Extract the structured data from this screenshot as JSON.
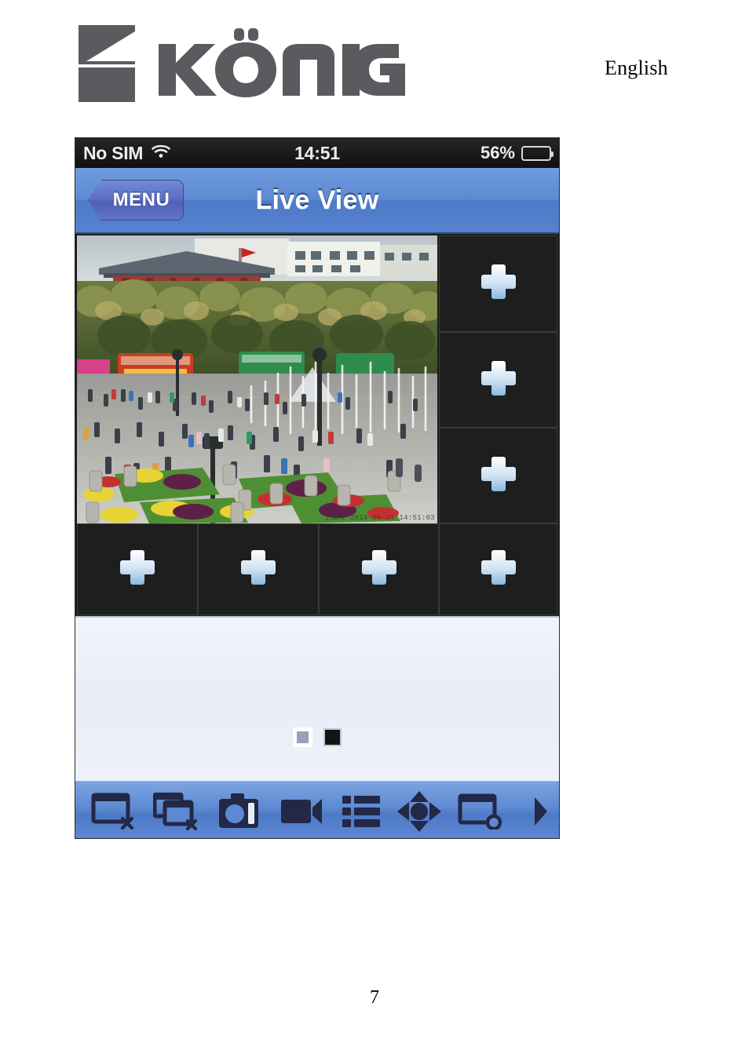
{
  "document": {
    "language_label": "English",
    "page_number": "7",
    "brand_name": "KÖNIG"
  },
  "phone": {
    "status_bar": {
      "carrier": "No SIM",
      "wifi_icon": "wifi-icon",
      "time": "14:51",
      "battery_percent": "56%",
      "battery_level": 56,
      "battery_icon": "battery-icon"
    },
    "nav_bar": {
      "back_button_label": "MENU",
      "title": "Live View"
    },
    "camera_grid": {
      "live_feed": {
        "label": "live-camera-feed",
        "timestamp_overlay": "上海市 2014-06-21 14:51:03"
      },
      "empty_cells": [
        {
          "id": "cell-r1",
          "icon": "plus-icon",
          "label": "+"
        },
        {
          "id": "cell-r2",
          "icon": "plus-icon",
          "label": "+"
        },
        {
          "id": "cell-r3",
          "icon": "plus-icon",
          "label": "+"
        },
        {
          "id": "cell-b1",
          "icon": "plus-icon",
          "label": "+"
        },
        {
          "id": "cell-b2",
          "icon": "plus-icon",
          "label": "+"
        },
        {
          "id": "cell-b3",
          "icon": "plus-icon",
          "label": "+"
        },
        {
          "id": "cell-b4",
          "icon": "plus-icon",
          "label": "+"
        }
      ]
    },
    "page_indicators": {
      "count": 2,
      "active_index": 1
    },
    "toolbar": {
      "buttons": [
        {
          "name": "close-window-button",
          "icon": "screen-close-icon"
        },
        {
          "name": "close-all-windows-button",
          "icon": "screens-close-all-icon"
        },
        {
          "name": "snapshot-button",
          "icon": "camera-icon"
        },
        {
          "name": "record-button",
          "icon": "video-camera-icon"
        },
        {
          "name": "device-list-button",
          "icon": "list-icon"
        },
        {
          "name": "ptz-control-button",
          "icon": "ptz-direction-icon"
        },
        {
          "name": "playback-button",
          "icon": "screen-record-icon"
        },
        {
          "name": "more-tools-button",
          "icon": "chevron-right-icon"
        }
      ]
    }
  },
  "colors": {
    "nav_blue": "#5d8ad3",
    "toolbar_blue": "#5d89d2",
    "cell_dark": "#1e1e1e",
    "plus_light": "#dce9f7",
    "plus_blue": "#8bb8de",
    "page_bg": "#e9edf7",
    "logo_gray": "#5a5a5f",
    "status_bar_black": "#1a1a1a"
  }
}
